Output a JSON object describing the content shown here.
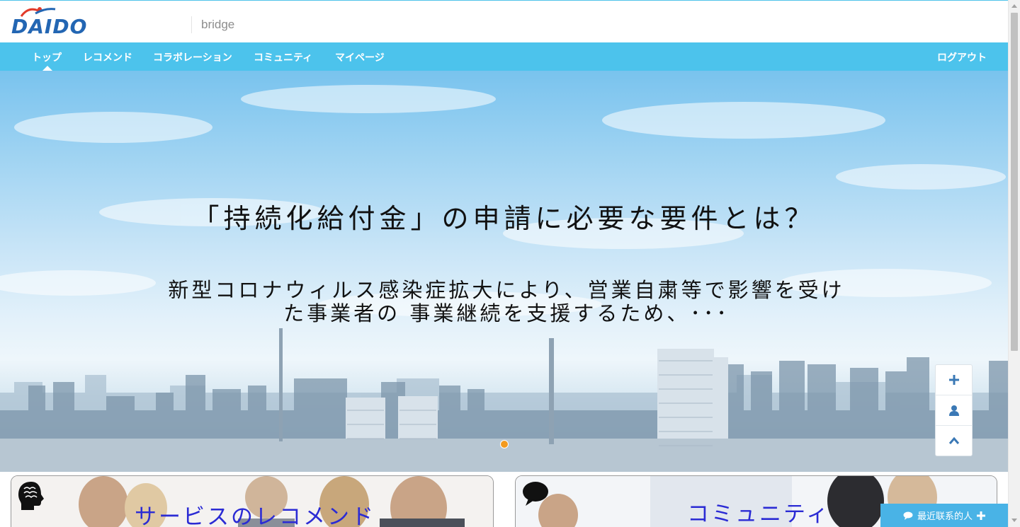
{
  "header": {
    "logo_text": "DAIDO",
    "subtitle": "bridge"
  },
  "nav": {
    "items": [
      {
        "label": "トップ"
      },
      {
        "label": "レコメンド"
      },
      {
        "label": "コラボレーション"
      },
      {
        "label": "コミュニティ"
      },
      {
        "label": "マイページ"
      }
    ],
    "logout": "ログアウト",
    "active_index": 0
  },
  "hero": {
    "title": "「持続化給付金」の申請に必要な要件とは？",
    "subtitle_line1": "新型コロナウィルス感染症拡大により、営業自粛等で影響を受け",
    "subtitle_line2": "た事業者の 事業継続を支援するため、･･･"
  },
  "float_tools": [
    {
      "icon": "plus-icon"
    },
    {
      "icon": "user-icon"
    },
    {
      "icon": "chevron-up-icon"
    }
  ],
  "cards": [
    {
      "title": "サービスのレコメンド",
      "icon": "brain-head-icon"
    },
    {
      "title": "コミュニティ",
      "icon": "speech-bubble-icon"
    }
  ],
  "chat": {
    "label": "最近联系的人"
  },
  "colors": {
    "nav_bg": "#4cc3ec",
    "logo_blue": "#2366b3",
    "card_title": "#2b2bd4",
    "slider_dot": "#f39a1e",
    "chat_bg": "#49b3e6"
  }
}
